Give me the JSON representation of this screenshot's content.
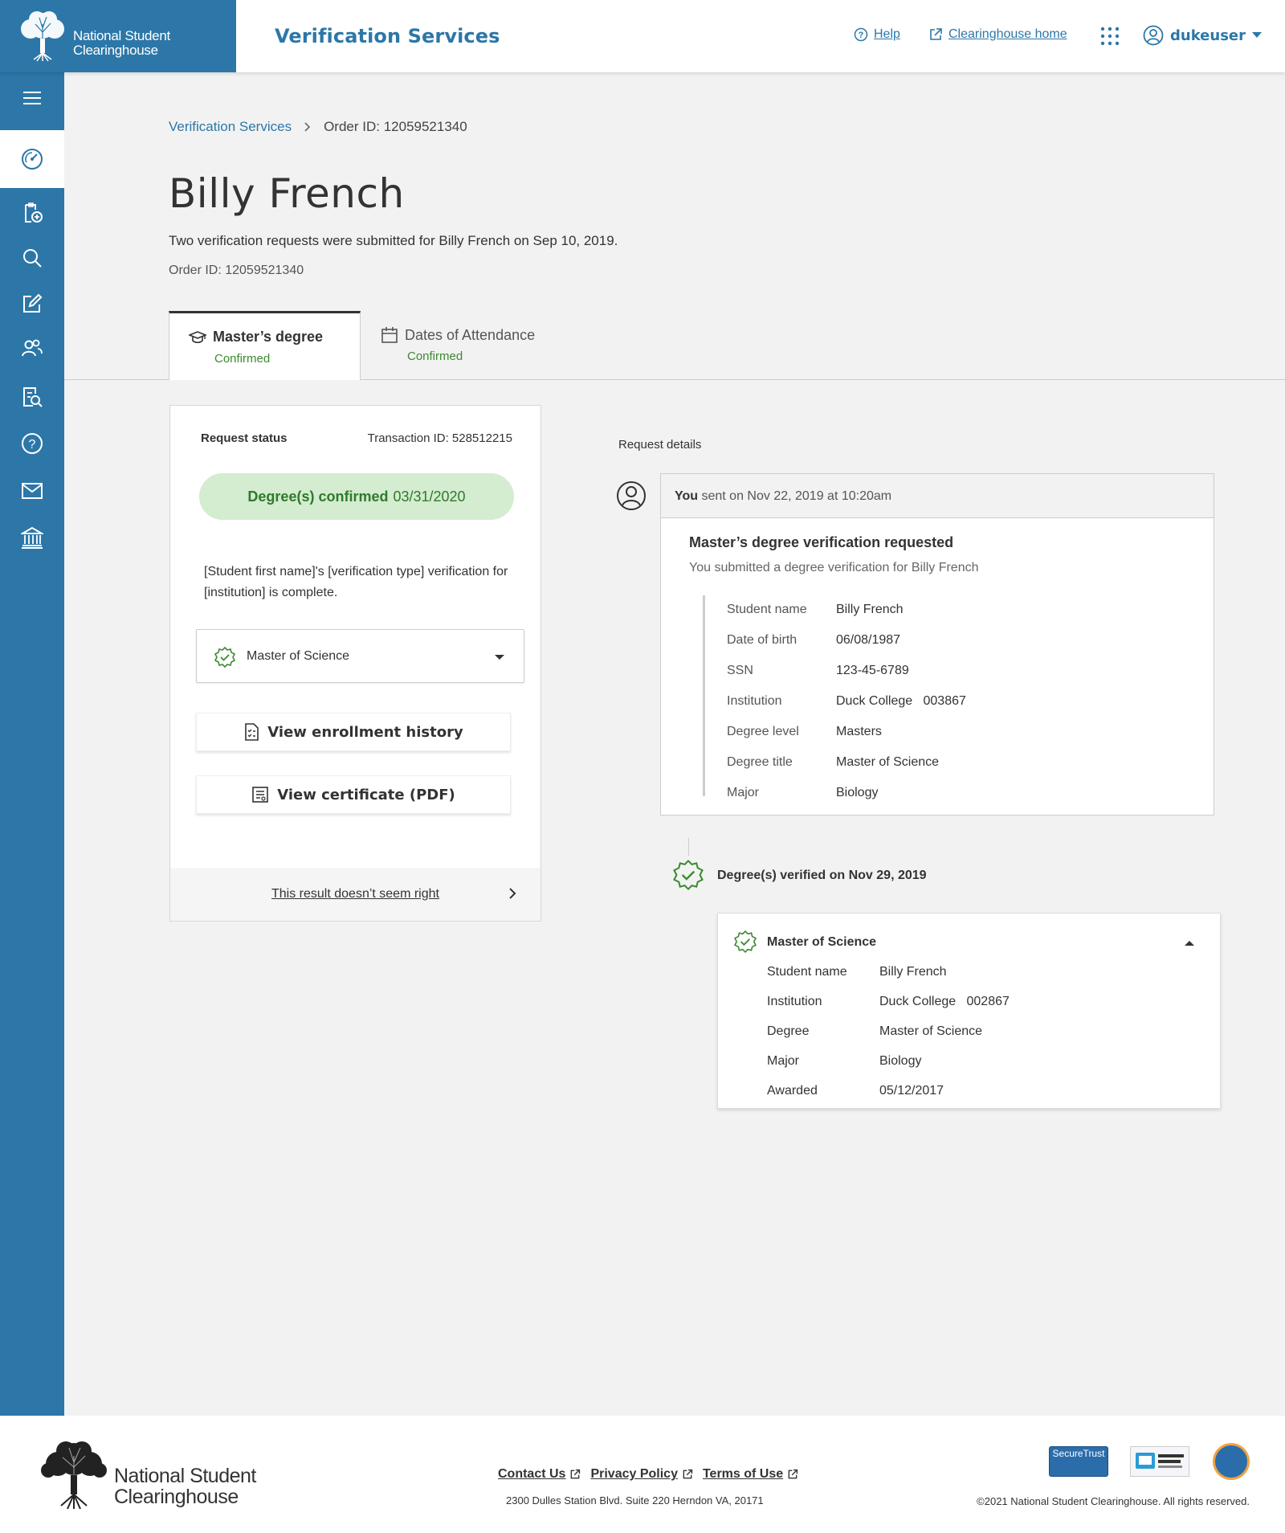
{
  "header": {
    "org_line1": "National Student",
    "org_line2": "Clearinghouse",
    "app_title": "Verification Services",
    "help_label": "Help",
    "home_label": "Clearinghouse home",
    "username": "dukeuser"
  },
  "sidebar": {
    "items": [
      {
        "icon": "menu-icon"
      },
      {
        "icon": "dashboard-icon"
      },
      {
        "icon": "add-document-icon"
      },
      {
        "icon": "search-icon"
      },
      {
        "icon": "edit-icon"
      },
      {
        "icon": "users-icon"
      },
      {
        "icon": "document-search-icon"
      },
      {
        "icon": "help-icon"
      },
      {
        "icon": "mail-icon"
      },
      {
        "icon": "institution-icon"
      }
    ]
  },
  "breadcrumb": {
    "root": "Verification Services",
    "current": "Order ID: 12059521340"
  },
  "page": {
    "title": "Billy French",
    "description": "Two verification requests were submitted for Billy French on Sep 10, 2019.",
    "order_id": "Order ID: 12059521340"
  },
  "tabs": [
    {
      "label": "Master’s degree",
      "status": "Confirmed"
    },
    {
      "label": "Dates of Attendance",
      "status": "Confirmed"
    }
  ],
  "status_card": {
    "label": "Request status",
    "transaction": "Transaction ID: 528512215",
    "pill_bold": "Degree(s) confirmed",
    "pill_date": "03/31/2020",
    "message": "[Student first name]'s [verification type] verification for [institution] is complete.",
    "select_value": "Master of Science",
    "enrollment_btn": "View enrollment history",
    "certificate_btn": "View certificate (PDF)",
    "footer_link": "This result doesn’t seem right"
  },
  "details": {
    "label": "Request details",
    "sender": "You",
    "sent_text": "sent on Nov 22, 2019 at 10:20am",
    "title": "Master’s degree verification requested",
    "subtitle": "You submitted a degree verification for Billy French",
    "fields": [
      {
        "label": "Student name",
        "value": "Billy French"
      },
      {
        "label": "Date of birth",
        "value": "06/08/1987"
      },
      {
        "label": "SSN",
        "value": "123-45-6789"
      },
      {
        "label": "Institution",
        "value": "Duck College   003867"
      },
      {
        "label": "Degree level",
        "value": "Masters"
      },
      {
        "label": "Degree title",
        "value": "Master of Science"
      },
      {
        "label": "Major",
        "value": "Biology"
      }
    ],
    "verified_text": "Degree(s) verified on Nov 29, 2019"
  },
  "degree_card": {
    "title": "Master of Science",
    "fields": [
      {
        "label": "Student name",
        "value": "Billy French"
      },
      {
        "label": "Institution",
        "value": "Duck College   002867"
      },
      {
        "label": "Degree",
        "value": "Master of Science"
      },
      {
        "label": "Major",
        "value": "Biology"
      },
      {
        "label": "Awarded",
        "value": "05/12/2017"
      }
    ]
  },
  "footer": {
    "org_line1": "National Student",
    "org_line2": "Clearinghouse",
    "links": [
      "Contact Us",
      "Privacy Policy",
      "Terms of Use"
    ],
    "address": "2300 Dulles Station Blvd. Suite 220 Herndon VA, 20171",
    "copyright": "©2021 National Student Clearinghouse. All rights reserved.",
    "badge_securetrust": "SecureTrust",
    "colors": {
      "brand_blue": "#2c77a8",
      "success_green": "#3b8b2f",
      "pill_bg": "#d4ecd0"
    }
  }
}
